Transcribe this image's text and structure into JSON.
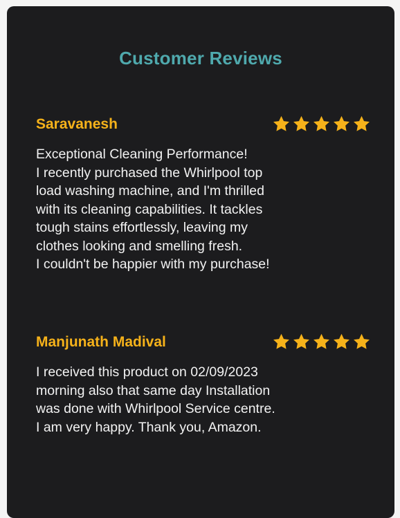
{
  "title": "Customer Reviews",
  "colors": {
    "card_bg": "#1c1c1e",
    "title": "#4fa9ad",
    "reviewer": "#f6b21a",
    "star": "#f6b21a",
    "body_text": "#f2f2f2"
  },
  "reviews": [
    {
      "name": "Saravanesh",
      "rating": 5,
      "lines": [
        "Exceptional Cleaning Performance!",
        "I recently purchased the Whirlpool top",
        "load washing machine, and I'm thrilled",
        "with its cleaning capabilities. It tackles",
        "tough stains effortlessly, leaving my",
        "clothes looking and smelling fresh.",
        "I couldn't be happier with my purchase!"
      ]
    },
    {
      "name": "Manjunath Madival",
      "rating": 5,
      "lines": [
        "I received this product on 02/09/2023",
        "morning also that same day Installation",
        "was done with Whirlpool Service centre.",
        "I am very happy. Thank you, Amazon."
      ]
    }
  ]
}
